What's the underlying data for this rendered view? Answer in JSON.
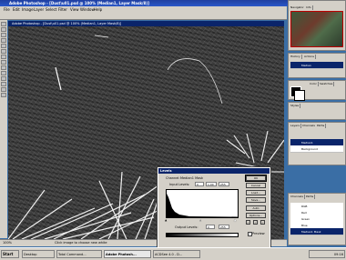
{
  "app": {
    "title": "Adobe Photoshop",
    "window_buttons": [
      "_",
      "□",
      "×"
    ]
  },
  "menu": [
    "File",
    "Edit",
    "Image",
    "Layer",
    "Select",
    "Filter",
    "View",
    "Window",
    "Help"
  ],
  "document": {
    "title": "Adobe Photoshop - [Dust\\u01.psd @ 100% (Median1, Layer Mask/8)]"
  },
  "status": {
    "zoom": "100%",
    "hint": "Click image to choose new white"
  },
  "levels": {
    "title": "Levels",
    "channel_label": "Channel:",
    "channel_value": "Median1 Mask",
    "input_label": "Input Levels:",
    "input_values": [
      "0",
      "1.00",
      "255"
    ],
    "output_label": "Output Levels:",
    "output_values": [
      "0",
      "255"
    ],
    "buttons": [
      "OK",
      "Cancel",
      "Load...",
      "Save...",
      "Auto",
      "Options..."
    ],
    "preview_label": "Preview",
    "preview_checked": true
  },
  "palettes": {
    "navigator_tabs": [
      "Navigator",
      "Info"
    ],
    "history_tabs": [
      "History",
      "Actions"
    ],
    "history_item": "Median",
    "color_tabs": [
      "Color",
      "Swatches"
    ],
    "styles_tabs": [
      "Styles"
    ],
    "layers_tabs": [
      "Layers",
      "Channels",
      "Paths"
    ],
    "layers": [
      "Median1",
      "Background"
    ],
    "channels_tabs": [
      "Channels",
      "Paths"
    ],
    "channels": [
      "RGB",
      "Red",
      "Green",
      "Blue",
      "Median1 Mask"
    ]
  },
  "taskbar": {
    "start_label": "Start",
    "items": [
      "Desktop",
      "Total Command...",
      "Adobe Photosh...",
      "ACDSee 4.0 - D..."
    ],
    "clock": "09:16"
  },
  "colors": {
    "titlebar": "#0a246a",
    "chrome": "#d4d0c8"
  }
}
